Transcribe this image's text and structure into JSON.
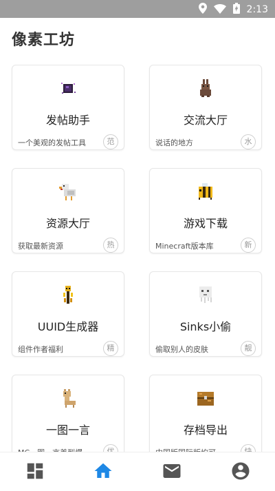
{
  "status": {
    "time": "2:13"
  },
  "app": {
    "title": "像素工坊"
  },
  "cards": [
    {
      "name": "发帖助手",
      "desc": "一个美观的发帖工具",
      "tag": "范",
      "icon": "ender-pearl-icon"
    },
    {
      "name": "交流大厅",
      "desc": "说话的地方",
      "tag": "水",
      "icon": "rabbit-icon"
    },
    {
      "name": "资源大厅",
      "desc": "获取最新资源",
      "tag": "热",
      "icon": "chicken-icon"
    },
    {
      "name": "游戏下载",
      "desc": "Minecraft版本库",
      "tag": "新",
      "icon": "bee-icon"
    },
    {
      "name": "UUID生成器",
      "desc": "组件作者福利",
      "tag": "精",
      "icon": "blaze-icon"
    },
    {
      "name": "Sinks小偷",
      "desc": "偷取别人的皮肤",
      "tag": "靓",
      "icon": "ghast-icon"
    },
    {
      "name": "一图一言",
      "desc": "MC一图一言美到爆",
      "tag": "优",
      "icon": "llama-icon"
    },
    {
      "name": "存档导出",
      "desc": "中国版国际版均可",
      "tag": "快",
      "icon": "chest-icon"
    }
  ],
  "nav": {
    "active": "home",
    "items": [
      "dashboard",
      "home",
      "mail",
      "account"
    ]
  },
  "colors": {
    "accent": "#1e88e5",
    "statusbar": "#9e9e9e"
  }
}
